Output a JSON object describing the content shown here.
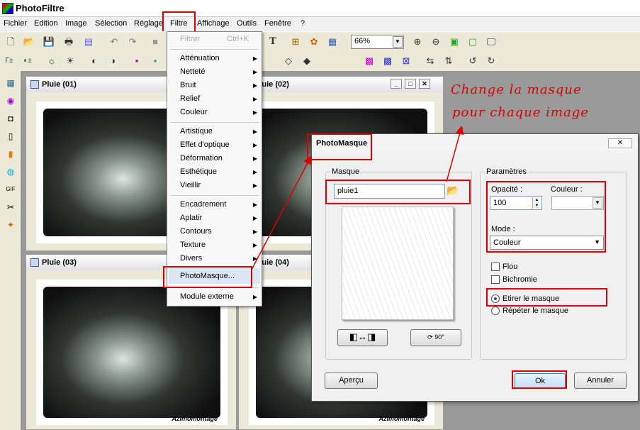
{
  "app": {
    "title": "PhotoFiltre"
  },
  "menubar": [
    "Fichier",
    "Edition",
    "Image",
    "Sélection",
    "Réglage",
    "Filtre",
    "Affichage",
    "Outils",
    "Fenêtre",
    "?"
  ],
  "toolbar": {
    "zoom": "66%"
  },
  "documents": [
    {
      "title": "Pluie (01)"
    },
    {
      "title": "Pluie (02)"
    },
    {
      "title": "Pluie (03)"
    },
    {
      "title": "Pluie (04)"
    }
  ],
  "signature": "Azimomontage",
  "filtre_menu": {
    "header": {
      "label": "Filtrer",
      "shortcut": "Ctrl+K"
    },
    "items": [
      {
        "label": "Atténuation"
      },
      {
        "label": "Netteté"
      },
      {
        "label": "Bruit"
      },
      {
        "label": "Relief"
      },
      {
        "label": "Couleur"
      },
      {
        "label": "Artistique"
      },
      {
        "label": "Effet d'optique"
      },
      {
        "label": "Déformation"
      },
      {
        "label": "Esthétique"
      },
      {
        "label": "Vieillir"
      },
      {
        "label": "Encadrement"
      },
      {
        "label": "Aplatir"
      },
      {
        "label": "Contours"
      },
      {
        "label": "Texture"
      },
      {
        "label": "Divers"
      },
      {
        "label": "PhotoMasque..."
      },
      {
        "label": "Module externe"
      }
    ]
  },
  "dialog": {
    "title": "PhotoMasque",
    "close_label": "✕",
    "masque_group": "Masque",
    "masque_value": "pluie1",
    "params_group": "Paramètres",
    "opacite_label": "Opacité :",
    "opacite_value": "100",
    "couleur_label": "Couleur :",
    "mode_label": "Mode :",
    "mode_value": "Couleur",
    "flou_label": "Flou",
    "bichromie_label": "Bichromie",
    "etirer_label": "Etirer le masque",
    "repeter_label": "Répéter le masque",
    "rotate_label": "90°",
    "apercu_label": "Aperçu",
    "ok_label": "Ok",
    "annuler_label": "Annuler"
  },
  "annotation": {
    "line1": "Change la masque",
    "line2": "pour chaque image"
  },
  "colors": {
    "highlight": "#d00000",
    "arrow": "#d00000"
  }
}
